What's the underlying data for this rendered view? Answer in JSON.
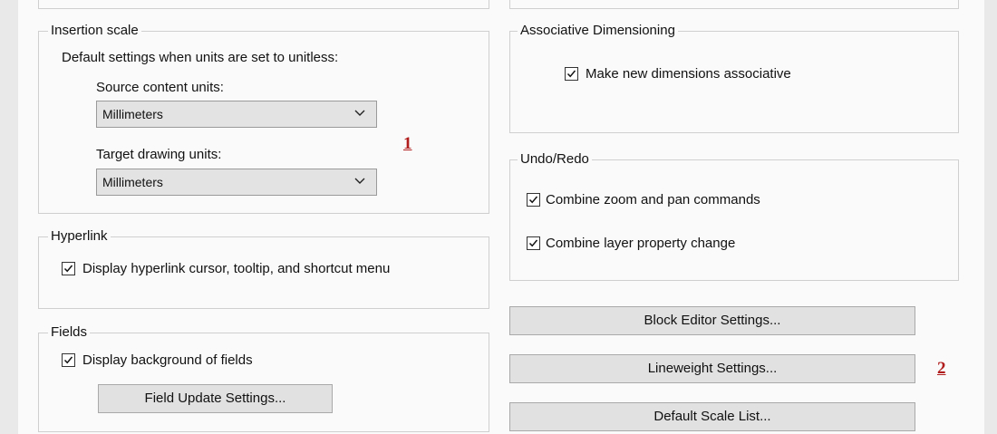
{
  "insertion_scale": {
    "title": "Insertion scale",
    "description": "Default settings when units are set to unitless:",
    "source_label": "Source content units:",
    "source_value": "Millimeters",
    "target_label": "Target drawing units:",
    "target_value": "Millimeters"
  },
  "hyperlink": {
    "title": "Hyperlink",
    "display_label": "Display hyperlink cursor, tooltip, and shortcut menu",
    "display_checked": true
  },
  "fields": {
    "title": "Fields",
    "background_label": "Display background of fields",
    "background_checked": true,
    "update_button": "Field Update Settings..."
  },
  "associative_dimensioning": {
    "title": "Associative Dimensioning",
    "associative_label": "Make new dimensions associative",
    "associative_checked": true
  },
  "undo_redo": {
    "title": "Undo/Redo",
    "zoom_pan_label": "Combine zoom and pan commands",
    "zoom_pan_checked": true,
    "layer_label": "Combine layer property change",
    "layer_checked": true
  },
  "buttons": {
    "block_editor": "Block Editor Settings...",
    "lineweight": "Lineweight Settings...",
    "scale_list": "Default Scale List..."
  },
  "markers": {
    "one": "1",
    "two": "2"
  },
  "icons": {
    "checkbox": "check-icon",
    "dropdown": "chevron-down-icon"
  }
}
